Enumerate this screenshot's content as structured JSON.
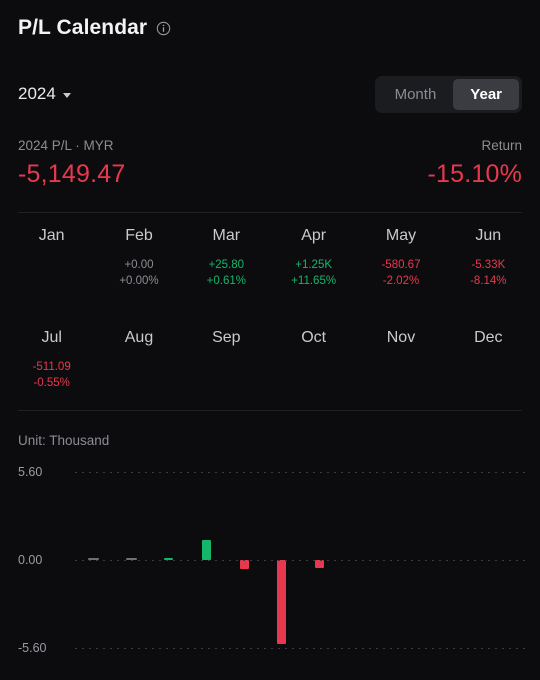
{
  "header": {
    "title": "P/L Calendar",
    "info_icon": "info-icon"
  },
  "controls": {
    "year": "2024",
    "caret_icon": "chevron-down-icon",
    "period_options": [
      "Month",
      "Year"
    ],
    "period_selected": "Year"
  },
  "summary": {
    "pl_label": "2024 P/L · MYR",
    "pl_value": "-5,149.47",
    "return_label": "Return",
    "return_value": "-15.10%"
  },
  "colors": {
    "positive": "#15b66c",
    "negative": "#e8384f",
    "neutral": "#8b8d93",
    "background": "#0c0c0e"
  },
  "months": [
    {
      "name": "Jan",
      "pl": "",
      "pct": "",
      "sign": "none"
    },
    {
      "name": "Feb",
      "pl": "+0.00",
      "pct": "+0.00%",
      "sign": "flat"
    },
    {
      "name": "Mar",
      "pl": "+25.80",
      "pct": "+0.61%",
      "sign": "pos"
    },
    {
      "name": "Apr",
      "pl": "+1.25K",
      "pct": "+11.65%",
      "sign": "pos"
    },
    {
      "name": "May",
      "pl": "-580.67",
      "pct": "-2.02%",
      "sign": "neg"
    },
    {
      "name": "Jun",
      "pl": "-5.33K",
      "pct": "-8.14%",
      "sign": "neg"
    },
    {
      "name": "Jul",
      "pl": "-511.09",
      "pct": "-0.55%",
      "sign": "neg"
    },
    {
      "name": "Aug",
      "pl": "",
      "pct": "",
      "sign": "none"
    },
    {
      "name": "Sep",
      "pl": "",
      "pct": "",
      "sign": "none"
    },
    {
      "name": "Oct",
      "pl": "",
      "pct": "",
      "sign": "none"
    },
    {
      "name": "Nov",
      "pl": "",
      "pct": "",
      "sign": "none"
    },
    {
      "name": "Dec",
      "pl": "",
      "pct": "",
      "sign": "none"
    }
  ],
  "chart_data": {
    "type": "bar",
    "title": "",
    "unit_label": "Unit: Thousand",
    "xlabel": "",
    "ylabel": "",
    "ylim": [
      -5.6,
      5.6
    ],
    "yticks": [
      5.6,
      0.0,
      -5.6
    ],
    "ytick_labels": [
      "5.60",
      "0.00",
      "-5.60"
    ],
    "grid": true,
    "legend": "none",
    "categories": [
      "Jan",
      "Feb",
      "Mar",
      "Apr",
      "May",
      "Jun",
      "Jul",
      "Aug",
      "Sep",
      "Oct",
      "Nov",
      "Dec"
    ],
    "values": [
      0,
      0,
      0.0258,
      1.25,
      -0.58067,
      -5.33,
      -0.51109,
      null,
      null,
      null,
      null,
      null
    ],
    "bar_colors": [
      "#6f7177",
      "#6f7177",
      "#15b66c",
      "#15b66c",
      "#e8384f",
      "#e8384f",
      "#e8384f",
      null,
      null,
      null,
      null,
      null
    ]
  }
}
